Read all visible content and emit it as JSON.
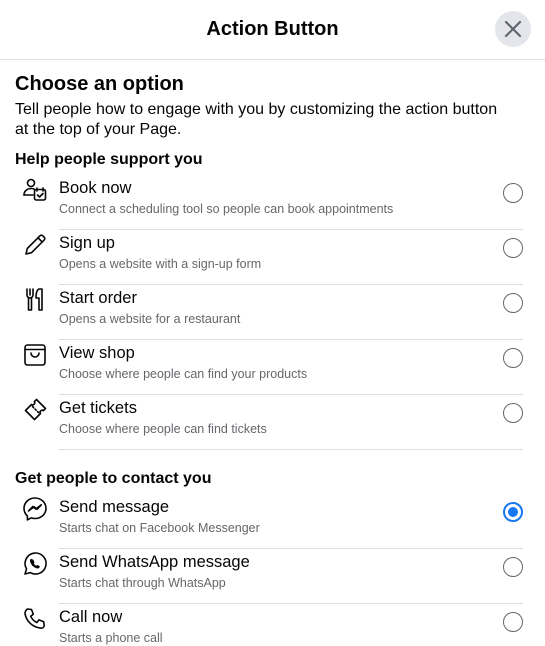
{
  "header": {
    "title": "Action Button"
  },
  "intro": {
    "title": "Choose an option",
    "description": "Tell people how to engage with you by customizing the action button at the top of your Page."
  },
  "sections": [
    {
      "title": "Help people support you",
      "items": [
        {
          "icon": "calendar-person-icon",
          "label": "Book now",
          "description": "Connect a scheduling tool so people can book appointments",
          "selected": false
        },
        {
          "icon": "pencil-icon",
          "label": "Sign up",
          "description": "Opens a website with a sign-up form",
          "selected": false
        },
        {
          "icon": "fork-knife-icon",
          "label": "Start order",
          "description": "Opens a website for a restaurant",
          "selected": false
        },
        {
          "icon": "shopping-bag-icon",
          "label": "View shop",
          "description": "Choose where people can find your products",
          "selected": false
        },
        {
          "icon": "ticket-icon",
          "label": "Get tickets",
          "description": "Choose where people can find tickets",
          "selected": false
        }
      ]
    },
    {
      "title": "Get people to contact you",
      "items": [
        {
          "icon": "messenger-icon",
          "label": "Send message",
          "description": "Starts chat on Facebook Messenger",
          "selected": true
        },
        {
          "icon": "whatsapp-icon",
          "label": "Send WhatsApp message",
          "description": "Starts chat through WhatsApp",
          "selected": false
        },
        {
          "icon": "phone-icon",
          "label": "Call now",
          "description": "Starts a phone call",
          "selected": false
        }
      ]
    }
  ],
  "colors": {
    "accent": "#1877f2",
    "text": "#050505",
    "secondary_text": "#65676b",
    "divider": "#dadde1"
  }
}
